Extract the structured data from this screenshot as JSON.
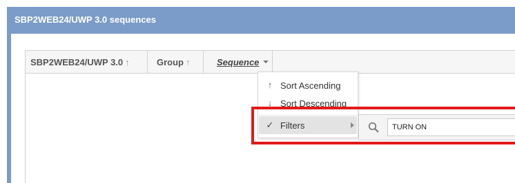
{
  "window": {
    "title": "SBP2WEB24/UWP 3.0 sequences"
  },
  "grid": {
    "columns": [
      {
        "label": "SBP2WEB24/UWP 3.0",
        "sort_indicator": "↑"
      },
      {
        "label": "Group",
        "sort_indicator": "↑"
      },
      {
        "label": "Sequence",
        "has_dropdown": true
      }
    ]
  },
  "menu": {
    "items": [
      {
        "label": "Sort Ascending",
        "icon": "↑"
      },
      {
        "label": "Sort Descending",
        "icon": "↓"
      },
      {
        "label": "Filters",
        "icon": "✓",
        "checked": true,
        "has_submenu": true
      }
    ]
  },
  "filter": {
    "value": "TURN ON",
    "icon": "search-icon"
  },
  "colors": {
    "titlebar": "#7b9cc8",
    "highlight": "#e21a1a"
  }
}
